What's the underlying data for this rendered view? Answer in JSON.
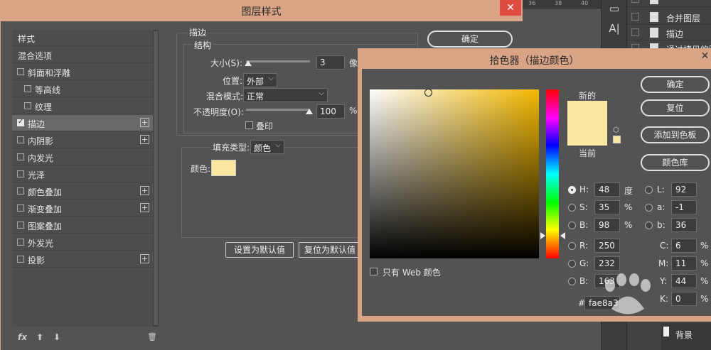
{
  "background": {
    "ruler_ticks": [
      "36",
      "38",
      "40"
    ],
    "tools": [
      {
        "icon": "type-tool-icon",
        "glyph": "A|"
      }
    ],
    "layers": [
      {
        "label": ""
      },
      {
        "label": "合并图层"
      },
      {
        "label": "描边"
      },
      {
        "label": "通过拷贝的图"
      }
    ],
    "bottom_layer": "背景"
  },
  "layer_style": {
    "title": "图层样式",
    "close_glyph": "✕",
    "list_header": "样式",
    "blend_options": "混合选项",
    "items": [
      {
        "label": "斜面和浮雕",
        "checked": false,
        "plus": false,
        "indent": false,
        "selected": false
      },
      {
        "label": "等高线",
        "checked": false,
        "plus": false,
        "indent": true,
        "selected": false
      },
      {
        "label": "纹理",
        "checked": false,
        "plus": false,
        "indent": true,
        "selected": false
      },
      {
        "label": "描边",
        "checked": true,
        "plus": true,
        "indent": false,
        "selected": true
      },
      {
        "label": "内阴影",
        "checked": false,
        "plus": true,
        "indent": false,
        "selected": false
      },
      {
        "label": "内发光",
        "checked": false,
        "plus": false,
        "indent": false,
        "selected": false
      },
      {
        "label": "光泽",
        "checked": false,
        "plus": false,
        "indent": false,
        "selected": false
      },
      {
        "label": "颜色叠加",
        "checked": false,
        "plus": true,
        "indent": false,
        "selected": false
      },
      {
        "label": "渐变叠加",
        "checked": false,
        "plus": true,
        "indent": false,
        "selected": false
      },
      {
        "label": "图案叠加",
        "checked": false,
        "plus": false,
        "indent": false,
        "selected": false
      },
      {
        "label": "外发光",
        "checked": false,
        "plus": false,
        "indent": false,
        "selected": false
      },
      {
        "label": "投影",
        "checked": false,
        "plus": true,
        "indent": false,
        "selected": false
      }
    ],
    "plus_glyph": "+",
    "bottom_icons": {
      "fx": "fx",
      "up": "⬆",
      "down": "⬇",
      "trash": "🗑"
    },
    "stroke": {
      "section_title": "描边",
      "structure_title": "结构",
      "size_label": "大小(S):",
      "size_value": "3",
      "size_unit": "像",
      "position_label": "位置:",
      "position_value": "外部",
      "blend_label": "混合模式:",
      "blend_value": "正常",
      "opacity_label": "不透明度(O):",
      "opacity_value": "100",
      "opacity_unit": "%",
      "overprint_label": "叠印",
      "fill_type_label": "填充类型:",
      "fill_type_value": "颜色",
      "color_label": "颜色:",
      "color_hex": "#fae8a2",
      "set_default_btn": "设置为默认值",
      "reset_default_btn": "复位为默认值"
    },
    "ok_btn": "确定"
  },
  "color_picker": {
    "title": "拾色器（描边颜色）",
    "close_glyph": "✕",
    "new_label": "新的",
    "current_label": "当前",
    "new_color": "#fae8a2",
    "current_color": "#fae8a2",
    "ok_btn": "确定",
    "reset_btn": "复位",
    "add_swatch_btn": "添加到色板",
    "color_lib_btn": "颜色库",
    "web_only_label": "只有 Web 颜色",
    "hsb": [
      {
        "label": "H:",
        "value": "48",
        "unit": "度",
        "selected": true
      },
      {
        "label": "S:",
        "value": "35",
        "unit": "%",
        "selected": false
      },
      {
        "label": "B:",
        "value": "98",
        "unit": "%",
        "selected": false
      }
    ],
    "rgb": [
      {
        "label": "R:",
        "value": "250"
      },
      {
        "label": "G:",
        "value": "232"
      },
      {
        "label": "B:",
        "value": "163"
      }
    ],
    "lab": [
      {
        "label": "L:",
        "value": "92"
      },
      {
        "label": "a:",
        "value": "-1"
      },
      {
        "label": "b:",
        "value": "36"
      }
    ],
    "cmyk": [
      {
        "label": "C:",
        "value": "6",
        "unit": "%"
      },
      {
        "label": "M:",
        "value": "11",
        "unit": "%"
      },
      {
        "label": "Y:",
        "value": "44",
        "unit": "%"
      },
      {
        "label": "K:",
        "value": "0",
        "unit": "%"
      }
    ],
    "hex_prefix": "#",
    "hex_value": "fae8a3"
  }
}
